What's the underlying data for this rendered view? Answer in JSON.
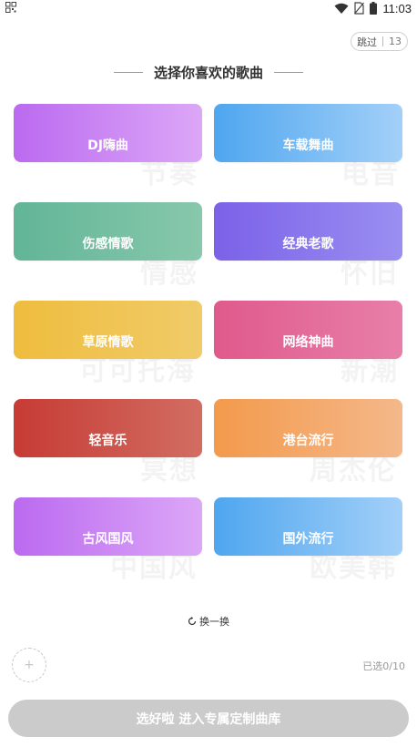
{
  "status_bar": {
    "time": "11:03",
    "icons": [
      "wifi-icon",
      "no-sim-icon",
      "battery-icon"
    ]
  },
  "header": {
    "skip_label": "跳过",
    "skip_count": "13",
    "title": "选择你喜欢的歌曲"
  },
  "cards": [
    {
      "label": "DJ嗨曲",
      "watermark": "节奏",
      "colors": [
        "#bb6af0",
        "#dca7f7"
      ]
    },
    {
      "label": "车载舞曲",
      "watermark": "电音",
      "colors": [
        "#4fa6ef",
        "#a3d0f8"
      ]
    },
    {
      "label": "伤感情歌",
      "watermark": "情感",
      "colors": [
        "#62b597",
        "#88c8ac"
      ]
    },
    {
      "label": "经典老歌",
      "watermark": "怀旧",
      "colors": [
        "#7b61e8",
        "#9a8ff1"
      ]
    },
    {
      "label": "草原情歌",
      "watermark": "可可托海",
      "colors": [
        "#efbd3e",
        "#f0cb69"
      ]
    },
    {
      "label": "网络神曲",
      "watermark": "新潮",
      "colors": [
        "#df5a8c",
        "#e87fa9"
      ]
    },
    {
      "label": "轻音乐",
      "watermark": "冥想",
      "colors": [
        "#c63b34",
        "#d26d62"
      ]
    },
    {
      "label": "港台流行",
      "watermark": "周杰伦",
      "colors": [
        "#f39a4c",
        "#f4b88a"
      ]
    },
    {
      "label": "古风国风",
      "watermark": "中国风",
      "colors": [
        "#bb6af0",
        "#dca7f7"
      ]
    },
    {
      "label": "国外流行",
      "watermark": "欧美韩",
      "colors": [
        "#4fa6ef",
        "#a3d0f8"
      ]
    }
  ],
  "refresh_label": "换一换",
  "selection": {
    "add_symbol": "+",
    "count_label": "已选0/10"
  },
  "confirm_button_label": "选好啦 进入专属定制曲库"
}
